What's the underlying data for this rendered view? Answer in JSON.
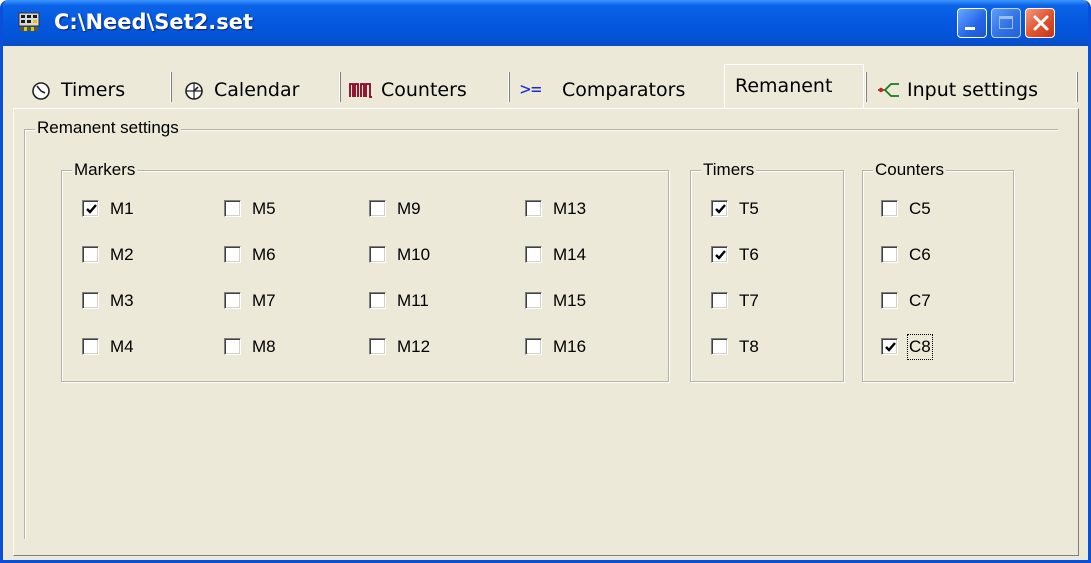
{
  "window": {
    "title": "C:\\Need\\Set2.set"
  },
  "tabs": [
    {
      "label": "Timers",
      "icon": "timer-icon"
    },
    {
      "label": "Calendar",
      "icon": "calendar-clock-icon"
    },
    {
      "label": "Counters",
      "icon": "counter-pulse-icon"
    },
    {
      "label": "Comparators",
      "icon": ">="
    },
    {
      "label": "Remanent",
      "active": true
    },
    {
      "label": "Input settings",
      "icon": "input-branch-icon"
    }
  ],
  "remanent": {
    "title": "Remanent settings",
    "markers": {
      "title": "Markers",
      "items": [
        {
          "label": "M1",
          "checked": true
        },
        {
          "label": "M2",
          "checked": false
        },
        {
          "label": "M3",
          "checked": false
        },
        {
          "label": "M4",
          "checked": false
        },
        {
          "label": "M5",
          "checked": false
        },
        {
          "label": "M6",
          "checked": false
        },
        {
          "label": "M7",
          "checked": false
        },
        {
          "label": "M8",
          "checked": false
        },
        {
          "label": "M9",
          "checked": false
        },
        {
          "label": "M10",
          "checked": false
        },
        {
          "label": "M11",
          "checked": false
        },
        {
          "label": "M12",
          "checked": false
        },
        {
          "label": "M13",
          "checked": false
        },
        {
          "label": "M14",
          "checked": false
        },
        {
          "label": "M15",
          "checked": false
        },
        {
          "label": "M16",
          "checked": false
        }
      ]
    },
    "timers": {
      "title": "Timers",
      "items": [
        {
          "label": "T5",
          "checked": true
        },
        {
          "label": "T6",
          "checked": true
        },
        {
          "label": "T7",
          "checked": false
        },
        {
          "label": "T8",
          "checked": false
        }
      ]
    },
    "counters": {
      "title": "Counters",
      "items": [
        {
          "label": "C5",
          "checked": false
        },
        {
          "label": "C6",
          "checked": false
        },
        {
          "label": "C7",
          "checked": false
        },
        {
          "label": "C8",
          "checked": true,
          "focused": true
        }
      ]
    }
  },
  "colors": {
    "titlebar": "#0558df",
    "face": "#ece9d8",
    "comparator_glyph": "#1a2bd6"
  }
}
